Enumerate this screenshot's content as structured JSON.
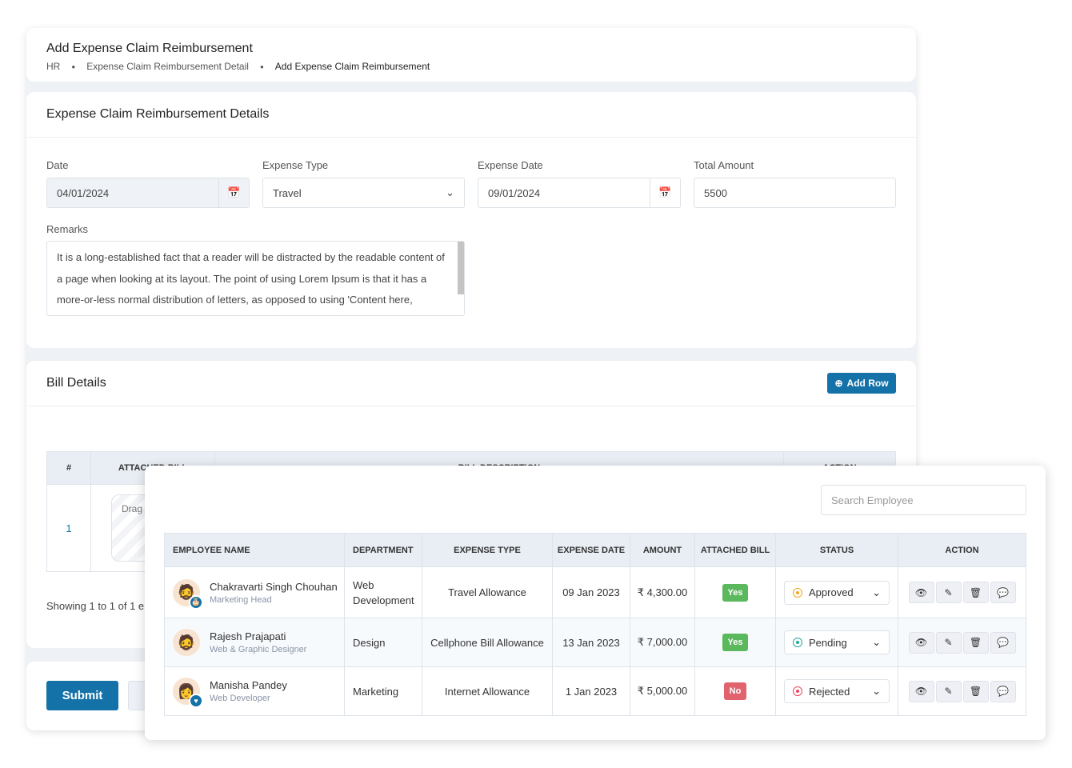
{
  "header": {
    "title": "Add Expense Claim Reimbursement",
    "breadcrumb": [
      "HR",
      "Expense Claim Reimbursement Detail",
      "Add Expense Claim Reimbursement"
    ]
  },
  "details": {
    "title": "Expense Claim Reimbursement Details",
    "date_label": "Date",
    "date_value": "04/01/2024",
    "type_label": "Expense Type",
    "type_value": "Travel",
    "exp_date_label": "Expense Date",
    "exp_date_value": "09/01/2024",
    "total_label": "Total Amount",
    "total_value": "5500",
    "remarks_label": "Remarks",
    "remarks_value": "It is a long-established fact that a reader will be distracted by the readable content of a page when looking at its layout. The point of using Lorem Ipsum is that it has a more-or-less normal distribution of letters, as opposed to using 'Content here,"
  },
  "bill": {
    "title": "Bill Details",
    "add_row": "Add Row",
    "columns": [
      "#",
      "ATTACHED BILL",
      "BILL DESCRIPTION",
      "ACTION"
    ],
    "row_index": "1",
    "drop_text": "Drag a file",
    "showing": "Showing 1 to 1 of 1 e"
  },
  "footer": {
    "submit": "Submit"
  },
  "employees": {
    "search_placeholder": "Search Employee",
    "columns": [
      "EMPLOYEE NAME",
      "DEPARTMENT",
      "EXPENSE TYPE",
      "EXPENSE DATE",
      "AMOUNT",
      "ATTACHED BILL",
      "STATUS",
      "ACTION"
    ],
    "rows": [
      {
        "name": "Chakravarti Singh Chouhan",
        "role": "Marketing Head",
        "dept": "Web Development",
        "type": "Travel Allowance",
        "date": "09 Jan 2023",
        "amount": "₹ 4,300.00",
        "bill": "Yes",
        "status": "Approved"
      },
      {
        "name": "Rajesh Prajapati",
        "role": "Web & Graphic Designer",
        "dept": "Design",
        "type": "Cellphone Bill Allowance",
        "date": "13 Jan 2023",
        "amount": "₹ 7,000.00",
        "bill": "Yes",
        "status": "Pending"
      },
      {
        "name": "Manisha Pandey",
        "role": "Web Developer",
        "dept": "Marketing",
        "type": "Internet Allowance",
        "date": "1 Jan 2023",
        "amount": "₹ 5,000.00",
        "bill": "No",
        "status": "Rejected"
      }
    ]
  },
  "colors": {
    "primary": "#1472a8",
    "yes": "#5cb85c",
    "no": "#e0636e",
    "approved": "#f5a623",
    "pending": "#26a69a",
    "rejected": "#f0435a"
  }
}
